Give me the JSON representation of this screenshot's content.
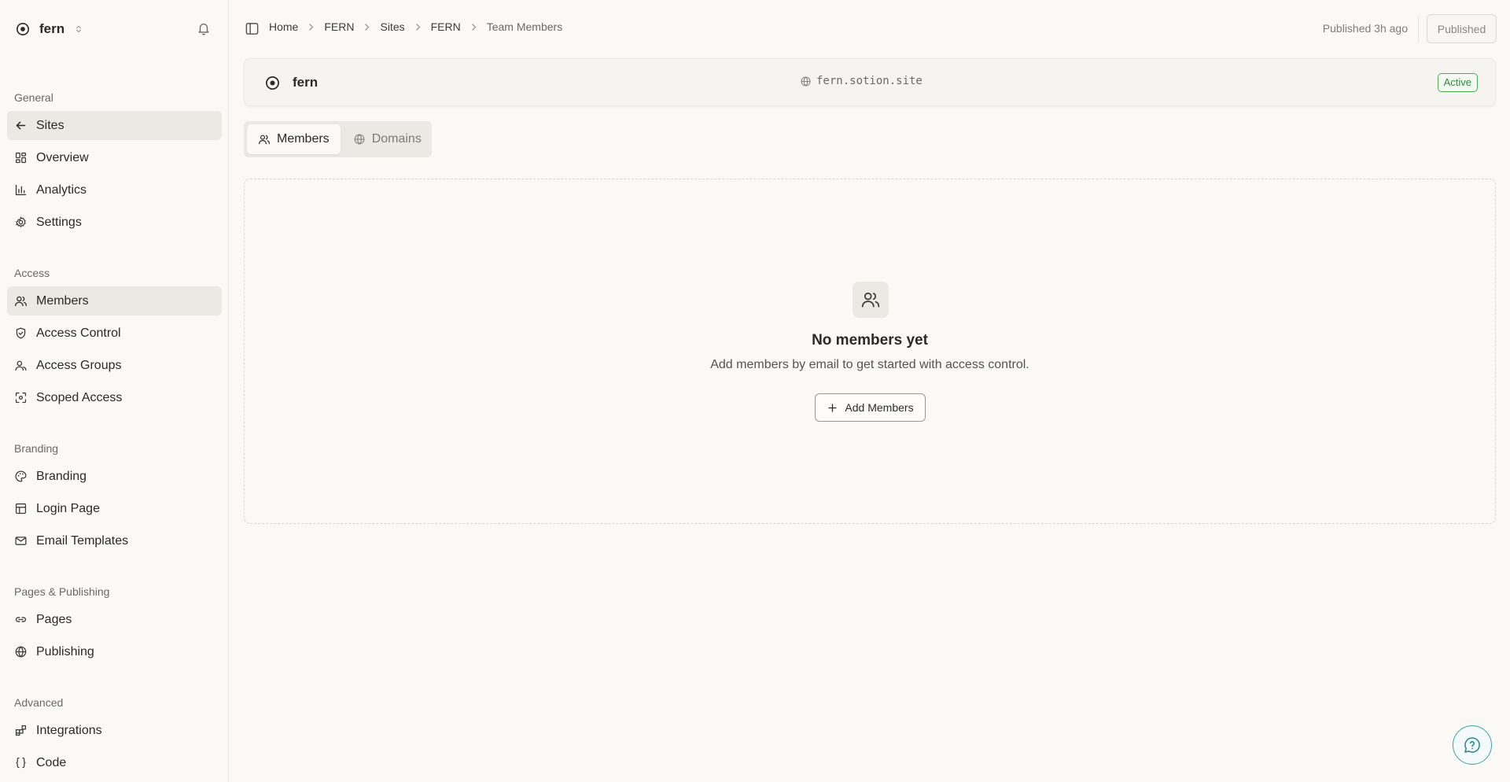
{
  "workspace": {
    "name": "fern",
    "icon": "target-icon",
    "switcher_icon": "chevrons-up-down-icon"
  },
  "notifications": {
    "icon": "bell-icon"
  },
  "sidebar": {
    "sections": [
      {
        "label": "General",
        "items": [
          {
            "label": "Sites",
            "icon": "arrow-left-icon",
            "active": true
          },
          {
            "label": "Overview",
            "icon": "dashboard-icon"
          },
          {
            "label": "Analytics",
            "icon": "bar-chart-icon"
          },
          {
            "label": "Settings",
            "icon": "gear-icon"
          }
        ]
      },
      {
        "label": "Access",
        "items": [
          {
            "label": "Members",
            "icon": "users-icon",
            "active": true
          },
          {
            "label": "Access Control",
            "icon": "shield-check-icon"
          },
          {
            "label": "Access Groups",
            "icon": "user-group-icon"
          },
          {
            "label": "Scoped Access",
            "icon": "scan-icon"
          }
        ]
      },
      {
        "label": "Branding",
        "items": [
          {
            "label": "Branding",
            "icon": "palette-icon"
          },
          {
            "label": "Login Page",
            "icon": "layout-icon"
          },
          {
            "label": "Email Templates",
            "icon": "mail-icon"
          }
        ]
      },
      {
        "label": "Pages & Publishing",
        "items": [
          {
            "label": "Pages",
            "icon": "link-icon"
          },
          {
            "label": "Publishing",
            "icon": "globe-icon"
          }
        ]
      },
      {
        "label": "Advanced",
        "items": [
          {
            "label": "Integrations",
            "icon": "blocks-icon"
          },
          {
            "label": "Code",
            "icon": "braces-icon"
          }
        ]
      }
    ]
  },
  "header": {
    "breadcrumb": [
      "Home",
      "FERN",
      "Sites",
      "FERN",
      "Team Members"
    ],
    "published_time": "Published 3h ago",
    "published_button": "Published"
  },
  "site": {
    "name": "fern",
    "url": "fern.sotion.site",
    "status": "Active",
    "status_color": "#2e8b3a"
  },
  "tabs": [
    {
      "label": "Members",
      "icon": "users-icon",
      "active": true
    },
    {
      "label": "Domains",
      "icon": "globe-icon",
      "active": false
    }
  ],
  "empty_state": {
    "icon": "users-icon",
    "title": "No members yet",
    "description": "Add members by email to get started with access control.",
    "button": "Add Members"
  },
  "help": {
    "icon": "help-chat-icon",
    "color": "#2a8e92"
  }
}
